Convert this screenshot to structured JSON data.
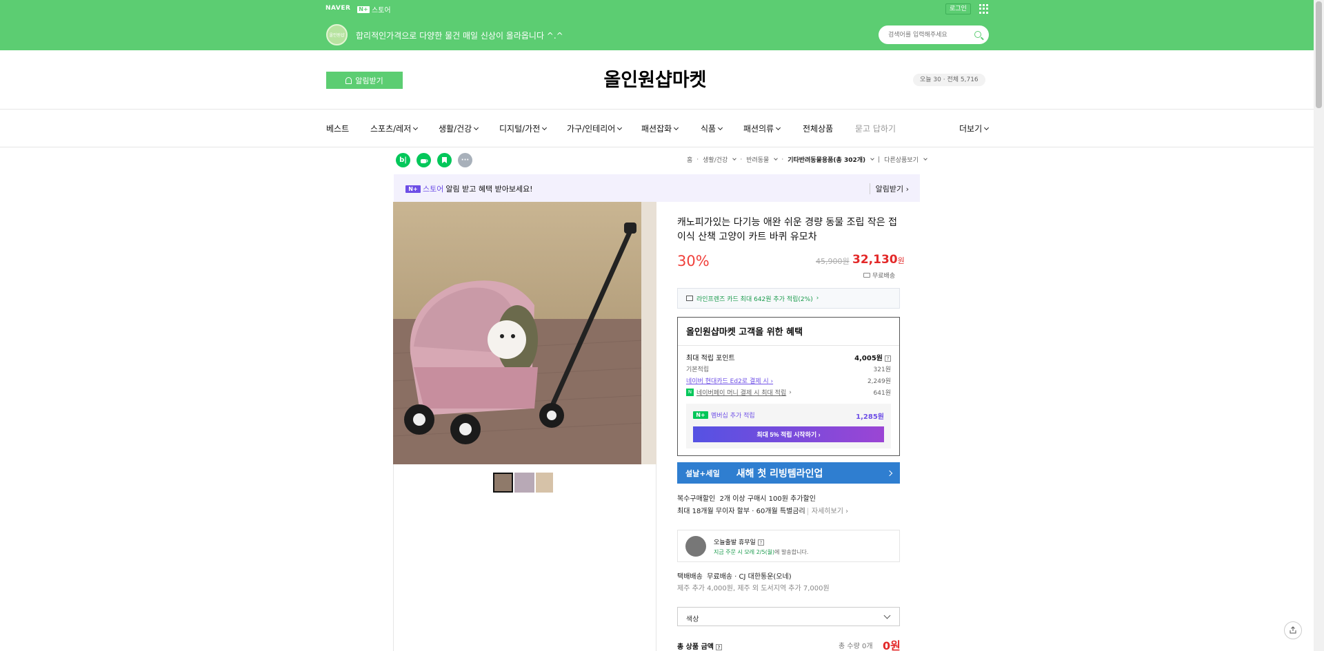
{
  "topbar": {
    "naver": "NAVER",
    "nstore_badge": "N+",
    "nstore_label": "스토어",
    "login": "로그인",
    "logo_text": "올인원샵",
    "notice": "합리적인가격으로 다양한 물건 매일 신상이 올라옵니다 ^.^",
    "search_placeholder": "검색어를 입력해주세요"
  },
  "header": {
    "alarm_button": "알림받기",
    "store_name": "올인원샵마켓",
    "visitors": "오늘 30 · 전체 5,716"
  },
  "nav": {
    "items": [
      "베스트",
      "스포츠/레저",
      "생활/건강",
      "디지털/가전",
      "가구/인테리어",
      "패션잡화",
      "식품",
      "패션의류",
      "전체상품",
      "묻고 답하기",
      "더보기"
    ]
  },
  "icons": {
    "blog": "b|",
    "talk": "☕",
    "bookmark": "🔖",
    "more": "···"
  },
  "breadcrumb": {
    "home": "홈",
    "c1": "생활/건강",
    "c2": "반려동물",
    "c3": "기타반려동물용품(총 302개)",
    "other": "다른상품보기"
  },
  "store_banner": {
    "badge": "N+",
    "store": "스토어",
    "text": "알림 받고 혜택 받아보세요!",
    "alarm": "알림받기"
  },
  "product": {
    "title": "캐노피가있는 다기능 애완 쉬운 경량 동물 조립 작은 접이식 산책 고양이 카트 바퀴 유모차",
    "discount": "30%",
    "original_price": "45,900원",
    "sale_price": "32,130",
    "won": "원",
    "free_shipping": "무료배송",
    "card_promo": "라인프렌즈 카드 최대 642원 추가 적립(2%)",
    "benefit": {
      "title": "올인원샵마켓 고객을 위한 혜택",
      "max_points_label": "최대 적립 포인트",
      "max_points_value": "4,005원",
      "basic_label": "기본적립",
      "basic_value": "321원",
      "card_label": "네이버 현대카드 Ed2로 결제 시",
      "card_value": "2,249원",
      "pay_label": "네이버페이 머니 결제 시 최대 적립",
      "pay_value": "641원",
      "membership_label": "멤버십 추가 적립",
      "membership_value": "1,285원",
      "membership_button": "최대 5% 적립 시작하기"
    },
    "ad": {
      "left": "설날+세일",
      "mid": "새해 첫 리빙템라인업"
    },
    "multi_discount_label": "복수구매할인",
    "multi_discount_text": "2개 이상 구매시 100원 추가할인",
    "installment": "최대 18개월 무이자 할부 · 60개월 특별금리",
    "installment_more": "자세히보기",
    "delivery": {
      "title": "오늘출발 휴무일",
      "sub_green": "지금 주문 시 모레 2/5(월)",
      "sub_rest": "에 발송합니다."
    },
    "shipping_label": "택배배송",
    "shipping_text": "무료배송 · CJ 대한통운(오네)",
    "shipping_extra": "제주 추가 4,000원, 제주 외 도서지역 추가 7,000원",
    "option_label": "색상",
    "total_label": "총 상품 금액",
    "total_count": "총 수량 0개",
    "total_amount": "0원"
  },
  "colors": {
    "brand_green": "#5ccd72",
    "sale_red": "#e32929",
    "purple": "#6d4ee6"
  }
}
